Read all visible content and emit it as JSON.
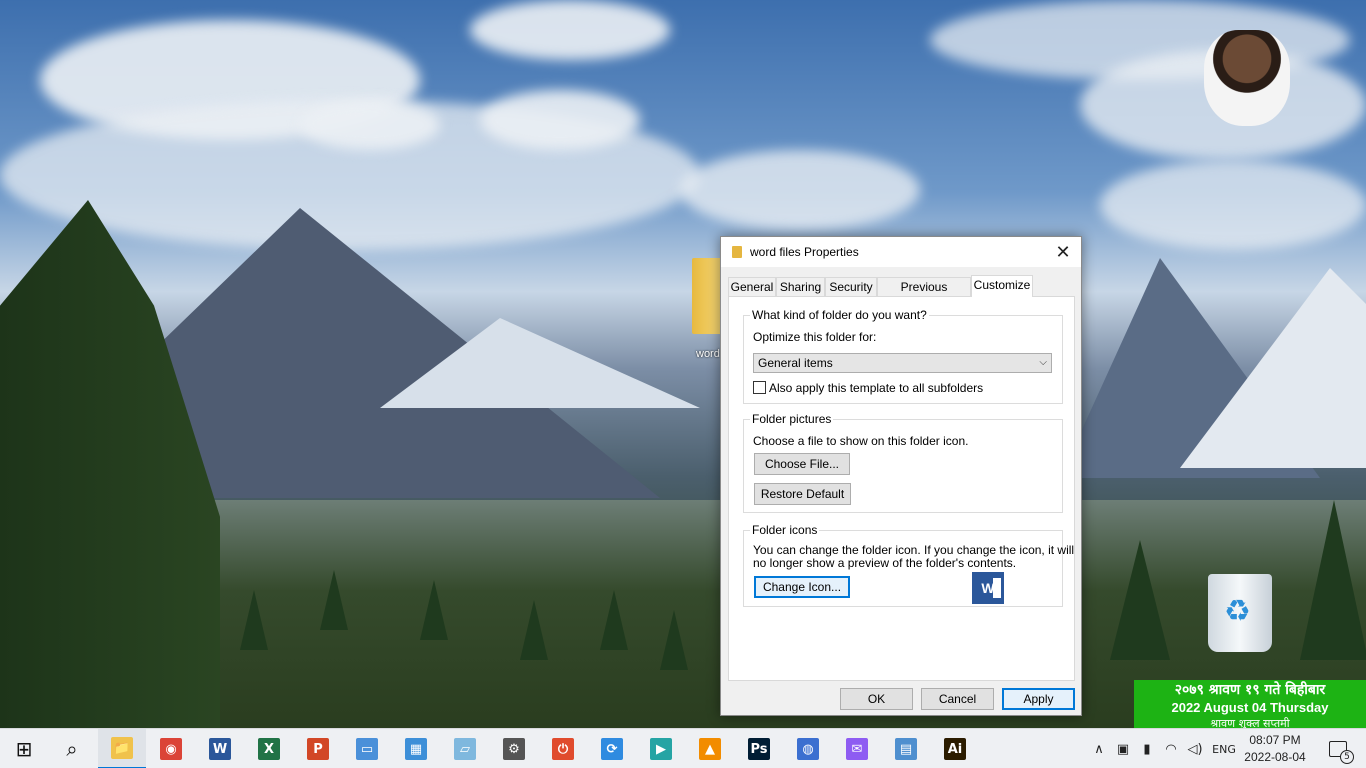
{
  "desktop": {
    "folder_label": "word",
    "date_widget": {
      "line1": "२०७९ श्रावण १९ गते बिहीबार",
      "line2": "2022 August 04  Thursday",
      "line3": "श्रावण  शुक्ल सप्तमी"
    }
  },
  "dialog": {
    "title": "word files Properties",
    "close_glyph": "✕",
    "tabs": [
      "General",
      "Sharing",
      "Security",
      "Previous Versions",
      "Customize"
    ],
    "active_tab": "Customize",
    "kind_group": {
      "legend": "What kind of folder do you want?",
      "optimize_label": "Optimize this folder for:",
      "optimize_value": "General items",
      "subfolders_label": "Also apply this template to all subfolders",
      "subfolders_checked": false
    },
    "pictures_group": {
      "legend": "Folder pictures",
      "description": "Choose a file to show on this folder icon.",
      "choose_button": "Choose File...",
      "restore_button": "Restore Default"
    },
    "icons_group": {
      "legend": "Folder icons",
      "description_line1": "You can change the folder icon. If you change the icon, it will",
      "description_line2": "no longer show a preview of the folder's contents.",
      "change_button": "Change Icon...",
      "preview_icon": "word-document-icon",
      "preview_letter": "W"
    },
    "ok_button": "OK",
    "cancel_button": "Cancel",
    "apply_button": "Apply"
  },
  "taskbar": {
    "apps": [
      {
        "name": "file-explorer",
        "label": "📁",
        "color": "#f0c24b",
        "active": true
      },
      {
        "name": "chrome",
        "label": "◉",
        "color": "#db4437"
      },
      {
        "name": "word",
        "label": "W",
        "color": "#2b579a"
      },
      {
        "name": "excel",
        "label": "X",
        "color": "#217346"
      },
      {
        "name": "powerpoint",
        "label": "P",
        "color": "#d24726"
      },
      {
        "name": "this-pc",
        "label": "▭",
        "color": "#4a90d9"
      },
      {
        "name": "control-panel",
        "label": "▦",
        "color": "#3d8fd8"
      },
      {
        "name": "notepad",
        "label": "▱",
        "color": "#7fb8de"
      },
      {
        "name": "settings",
        "label": "⚙",
        "color": "#555555"
      },
      {
        "name": "power",
        "label": "⏻",
        "color": "#e04b2d"
      },
      {
        "name": "sync",
        "label": "⟳",
        "color": "#2f8be0"
      },
      {
        "name": "filmora",
        "label": "▶",
        "color": "#25a4a4"
      },
      {
        "name": "vlc",
        "label": "▲",
        "color": "#f28c00"
      },
      {
        "name": "photoshop",
        "label": "Ps",
        "color": "#001d34"
      },
      {
        "name": "word-viewer",
        "label": "◍",
        "color": "#3b6fd0"
      },
      {
        "name": "messenger",
        "label": "✉",
        "color": "#8e5cf2"
      },
      {
        "name": "window-app",
        "label": "▤",
        "color": "#4e8fcf"
      },
      {
        "name": "illustrator",
        "label": "Ai",
        "color": "#2b1c00"
      }
    ],
    "search_glyph": "⌕",
    "start_glyph": "⊞",
    "tray": {
      "chevron": "∧",
      "meet": "▣",
      "battery": "▮",
      "wifi": "◠",
      "volume": "◁)",
      "language": "ENG",
      "time": "08:07 PM",
      "date": "2022-08-04",
      "notifications": "5"
    }
  }
}
